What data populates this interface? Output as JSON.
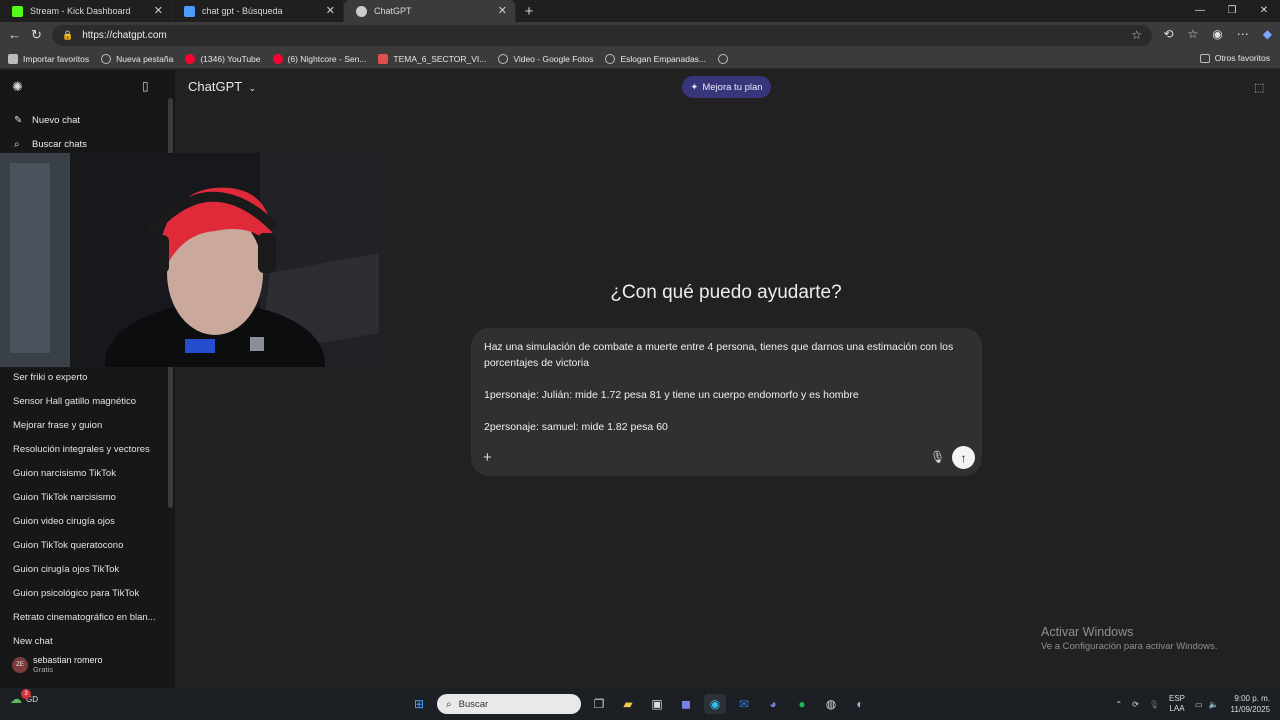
{
  "browser": {
    "tabs": [
      {
        "title": "Stream - Kick Dashboard",
        "color": "#53fc18",
        "active": false
      },
      {
        "title": "chat gpt - Búsqueda",
        "color": "#4a9cff",
        "active": false
      },
      {
        "title": "ChatGPT",
        "color": "#cccccc",
        "active": true
      }
    ],
    "url": "https://chatgpt.com",
    "bookmarks": [
      {
        "label": "Importar favoritos",
        "color": "#bbbbbb"
      },
      {
        "label": "Nueva pestaña",
        "color": "#bbbbbb"
      },
      {
        "label": "(1346) YouTube",
        "color": "#ff0033"
      },
      {
        "label": "(6) Nightcore - Sen...",
        "color": "#ff0033"
      },
      {
        "label": "TEMA_6_SECTOR_VI...",
        "color": "#e05050"
      },
      {
        "label": "Video - Google Fotos",
        "color": "#bbbbbb"
      },
      {
        "label": "Eslogan Empanadas...",
        "color": "#bbbbbb"
      },
      {
        "label": "",
        "color": "#bbbbbb"
      }
    ],
    "other_favorites": "Otros favoritos"
  },
  "sidebar": {
    "new_chat": "Nuevo chat",
    "search_chats": "Buscar chats",
    "chats": [
      "Ser friki o experto",
      "Sensor Hall gatillo magnético",
      "Mejorar frase y guion",
      "Resolución integrales y vectores",
      "Guion narcisismo TikTok",
      "Guion TikTok narcisismo",
      "Guion video cirugía ojos",
      "Guion TikTok queratocono",
      "Guion cirugía ojos TikTok",
      "Guion psicológico para TikTok",
      "Retrato cinematográfico en blan...",
      "New chat"
    ],
    "user": {
      "initials": "ZE",
      "name": "sebastian romero",
      "plan": "Gratis"
    }
  },
  "main": {
    "model": "ChatGPT",
    "upgrade": "Mejora tu plan",
    "heading": "¿Con qué puedo ayudarte?",
    "prompt_lines": [
      "Haz una simulación de combate a muerte entre 4 persona, tienes que darnos una estimación con los porcentajes de victoria",
      "1personaje: Julián: mide 1.72 pesa 81 y tiene un cuerpo endomorfo y es hombre",
      "2personaje: samuel: mide 1.82 pesa 60"
    ]
  },
  "watermark": {
    "title": "Activar Windows",
    "subtitle": "Ve a Configuración para activar Windows."
  },
  "taskbar": {
    "weather_badge": "3",
    "weather_label": "GD",
    "search_placeholder": "Buscar",
    "lang_top": "ESP",
    "lang_bottom": "LAA",
    "time": "9:00 p. m.",
    "date": "11/09/2025"
  }
}
